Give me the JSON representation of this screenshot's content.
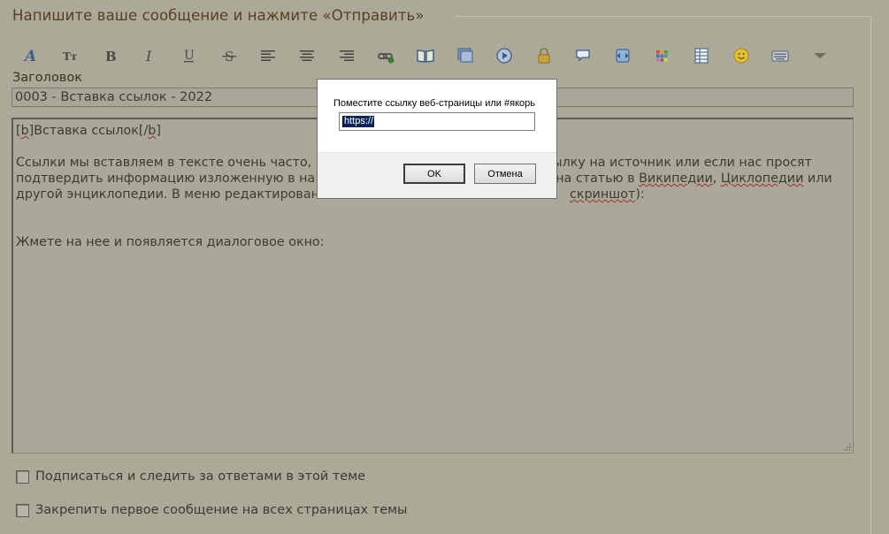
{
  "form": {
    "heading": "Напишите ваше сообщение и нажмите «Отправить»",
    "title_label": "Заголовок",
    "title_value": "0003 - Вставка ссылок - 2022"
  },
  "toolbar": {
    "buttons": [
      "font-style-icon",
      "font-size-icon",
      "bold-icon",
      "italic-icon",
      "underline-icon",
      "strikethrough-icon",
      "align-left-icon",
      "align-center-icon",
      "align-right-icon",
      "insert-link-icon",
      "book-icon",
      "insert-image-icon",
      "insert-video-icon",
      "lock-icon",
      "quote-icon",
      "code-icon",
      "color-icon",
      "table-icon",
      "smiley-icon",
      "keyboard-icon",
      "more-dropdown-icon"
    ]
  },
  "editor": {
    "line1_open": "[",
    "line1_tag_b": "b",
    "line1_mid": "]Вставка ссылок[/",
    "line1_tag_b2": "b",
    "line1_close": "]",
    "line3_a": "Ссылки мы вставляем в тексте очень часто,",
    "line3_b": "ылку на источник или если нас просят",
    "line4_a": "подтвердить информацию изложенную в на",
    "line4_b": "на статью в ",
    "line4_wiki": "Википедии",
    "line4_sep": ", ",
    "line4_cyclo": "Циклопедии",
    "line4_end": " или",
    "line5_a": "другой энциклопедии. В меню редактирован",
    "line5_b": "скриншот",
    "line5_end": "):",
    "line8": "Жмете на нее и появляется диалоговое окно:"
  },
  "options": {
    "subscribe": "Подписаться и следить за ответами в этой теме",
    "pin_first": "Закрепить первое сообщение на всех страницах темы"
  },
  "dialog": {
    "prompt": "Поместите ссылку веб-страницы или #якорь",
    "value": "https://",
    "ok": "OK",
    "cancel": "Отмена"
  }
}
